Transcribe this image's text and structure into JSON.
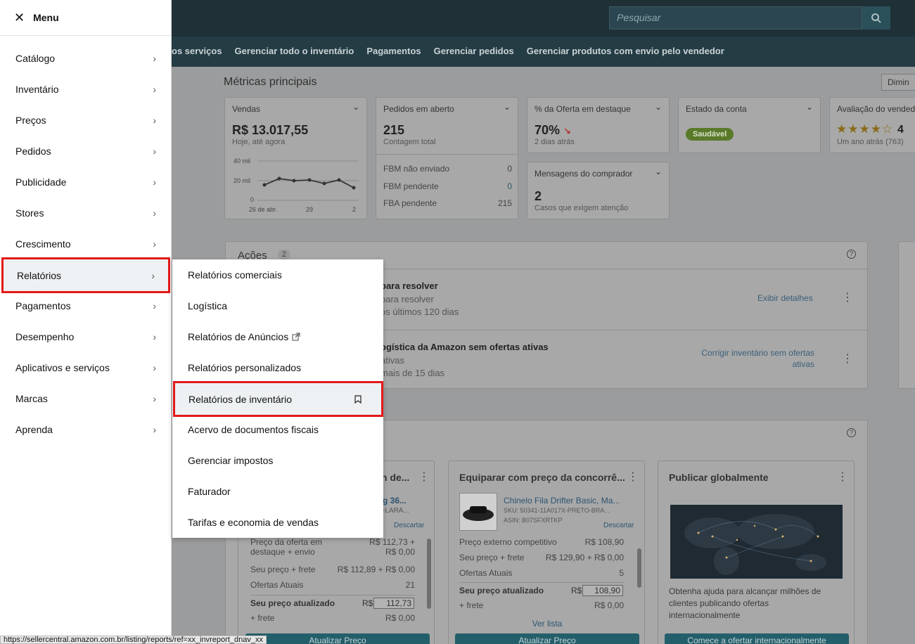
{
  "search": {
    "placeholder": "Pesquisar"
  },
  "nav": {
    "links": [
      "os serviços",
      "Gerenciar todo o inventário",
      "Pagamentos",
      "Gerenciar pedidos",
      "Gerenciar produtos com envio pelo vendedor"
    ]
  },
  "metrics": {
    "title": "Métricas principais",
    "dim_button": "Dimin",
    "vendas": {
      "label": "Vendas",
      "value": "R$ 13.017,55",
      "sub": "Hoje, até agora",
      "y_ticks": [
        "40 mil",
        "20 mil",
        "0"
      ],
      "x_ticks": [
        "26 de abr.",
        "29",
        "2"
      ]
    },
    "pedidos": {
      "label": "Pedidos em aberto",
      "value": "215",
      "sub": "Contagem total",
      "rows": [
        {
          "label": "FBM não enviado",
          "value": "0"
        },
        {
          "label": "FBM pendente",
          "value": "0"
        },
        {
          "label": "FBA pendente",
          "value": "215"
        }
      ]
    },
    "oferta": {
      "label": "% da Oferta em destaque",
      "value": "70%",
      "sub": "2 dias atrás"
    },
    "mensagens": {
      "label": "Mensagens do comprador",
      "value": "2",
      "sub": "Casos que exigem atenção"
    },
    "estado": {
      "label": "Estado da conta",
      "badge": "Saudável"
    },
    "avaliacao": {
      "label": "Avaliação do vended",
      "value": "4",
      "sub": "Um ano atrás (763)"
    }
  },
  "acoes": {
    "title": "Ações",
    "count": "2",
    "rows": [
      {
        "title": "para resolver",
        "l1": "para resolver",
        "l2": "os últimos 120 dias",
        "link": "Exibir detalhes"
      },
      {
        "title": "ogística da Amazon sem ofertas ativas",
        "l1": "ativas",
        "l2": "mais de 15 dias",
        "link": "Corrigir inventário sem ofertas ativas"
      }
    ]
  },
  "cards": {
    "c1": {
      "title": "n de...",
      "sku_line": "g 36...",
      "sku2": "-LARA...",
      "discard": "Descartar",
      "rows": [
        {
          "label": "Preço da oferta em destaque + envio",
          "value": "R$ 112,73 + R$ 0,00"
        },
        {
          "label": "Seu preço + frete",
          "value": "R$ 112,89 + R$ 0,00"
        },
        {
          "label": "Ofertas Atuais",
          "value": "21"
        }
      ],
      "updated_label": "Seu preço atualizado",
      "currency": "R$",
      "updated_value": "112,73",
      "frete_label": "+ frete",
      "frete_value": "R$ 0,00",
      "button": "Atualizar Preço"
    },
    "c2": {
      "title": "Equiparar com preço da concorrê...",
      "product": "Chinelo Fila Drifter Basic, Ma...",
      "sku": "SKU: 50341-11A017X-PRETO-BRA...",
      "asin": "ASIN: B07SFXRTKP",
      "discard": "Descartar",
      "rows": [
        {
          "label": "Preço externo competitivo",
          "value": "R$ 108,90"
        },
        {
          "label": "Seu preço + frete",
          "value": "R$ 129,90 + R$ 0,00"
        },
        {
          "label": "Ofertas Atuais",
          "value": "5"
        }
      ],
      "updated_label": "Seu preço atualizado",
      "currency": "R$",
      "updated_value": "108,90",
      "frete_label": "+ frete",
      "frete_value": "R$ 0,00",
      "view_list": "Ver lista",
      "button": "Atualizar Preço"
    },
    "c3": {
      "title": "Publicar globalmente",
      "desc": "Obtenha ajuda para alcançar milhões de clientes publicando ofertas internacionalmente",
      "button": "Comece a ofertar internacionalmente"
    }
  },
  "menu": {
    "title": "Menu",
    "items": [
      "Catálogo",
      "Inventário",
      "Preços",
      "Pedidos",
      "Publicidade",
      "Stores",
      "Crescimento",
      "Relatórios",
      "Pagamentos",
      "Desempenho",
      "Aplicativos e serviços",
      "Marcas",
      "Aprenda"
    ]
  },
  "submenu": {
    "items": [
      "Relatórios comerciais",
      "Logística",
      "Relatórios de Anúncios",
      "Relatórios personalizados",
      "Relatórios de inventário",
      "Acervo de documentos fiscais",
      "Gerenciar impostos",
      "Faturador",
      "Tarifas e economia de vendas"
    ]
  },
  "status_url": "https://sellercentral.amazon.com.br/listing/reports/ref=xx_invreport_dnav_xx"
}
